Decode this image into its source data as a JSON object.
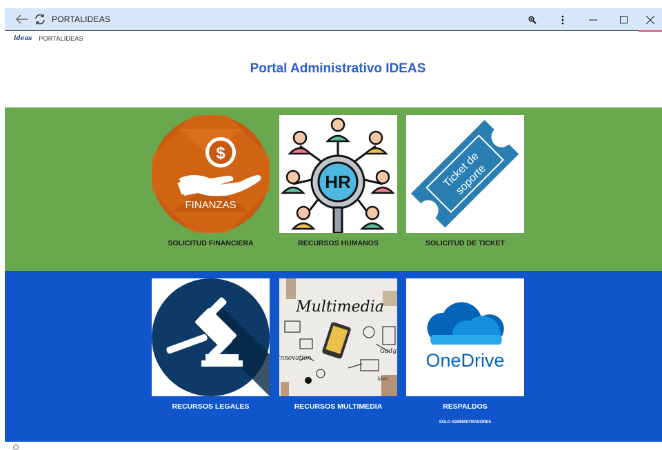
{
  "window": {
    "title": "PORTALIDEAS",
    "icons": {
      "back": "back-arrow-icon",
      "reload": "reload-icon",
      "zoom": "zoom-icon",
      "menu": "more-vert-icon",
      "minimize": "minimize-icon",
      "maximize": "maximize-icon",
      "close": "close-icon"
    }
  },
  "header": {
    "logo_text": "ideas",
    "site_name": "PORTALIDEAS"
  },
  "page": {
    "title": "Portal Administrativo IDEAS"
  },
  "colors": {
    "green_band": "#6aa84f",
    "blue_band": "#1155cc",
    "title": "#2a5ec9",
    "titlebar": "#d6e6fb"
  },
  "tiles_top": [
    {
      "label": "SOLICITUD FINANCIERA",
      "image_text": "FINANZAS",
      "icon": "finance-hand-dollar-icon"
    },
    {
      "label": "RECURSOS HUMANOS",
      "image_text": "HR",
      "icon": "hr-people-network-icon"
    },
    {
      "label": "SOLICITUD DE TICKET",
      "image_text": [
        "Ticket de",
        "soporte"
      ],
      "icon": "support-ticket-icon"
    }
  ],
  "tiles_bottom": [
    {
      "label": "RECURSOS LEGALES",
      "icon": "gavel-icon"
    },
    {
      "label": "RECURSOS MULTIMEDIA",
      "image_text": [
        "Multimedia",
        "Innovation",
        "Gadg",
        "Idea"
      ],
      "icon": "multimedia-doodle-icon"
    },
    {
      "label": "RESPALDOS",
      "sublabel": "SOLO ADMINISTRADORES",
      "image_text": "OneDrive",
      "icon": "onedrive-cloud-icon"
    }
  ]
}
